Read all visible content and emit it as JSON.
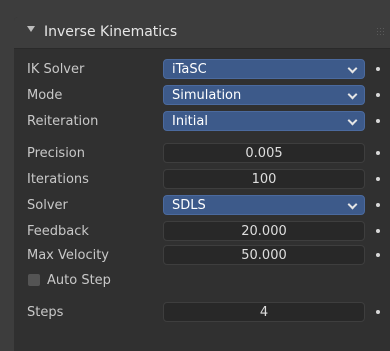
{
  "panel": {
    "title": "Inverse Kinematics",
    "rows": [
      {
        "label": "IK Solver",
        "kind": "dropdown",
        "value": "iTaSC"
      },
      {
        "label": "Mode",
        "kind": "dropdown",
        "value": "Simulation"
      },
      {
        "label": "Reiteration",
        "kind": "dropdown",
        "value": "Initial"
      },
      {
        "label": "Precision",
        "kind": "number",
        "value": "0.005"
      },
      {
        "label": "Iterations",
        "kind": "number",
        "value": "100"
      },
      {
        "label": "Solver",
        "kind": "dropdown",
        "value": "SDLS"
      },
      {
        "label": "Feedback",
        "kind": "number",
        "value": "20.000"
      },
      {
        "label": "Max Velocity",
        "kind": "number",
        "value": "50.000"
      }
    ],
    "auto_step": {
      "label": "Auto Step",
      "checked": false
    },
    "steps": {
      "label": "Steps",
      "value": "4"
    }
  },
  "colors": {
    "panel_bg": "#303030",
    "header_bg": "#3d3d3d",
    "dropdown_bg": "#3d5a8a",
    "number_bg": "#282828"
  },
  "icons": [
    "collapse-arrow-icon",
    "chevron-down-icon",
    "animate-dot-icon",
    "drag-grip-icon",
    "checkbox-icon"
  ]
}
